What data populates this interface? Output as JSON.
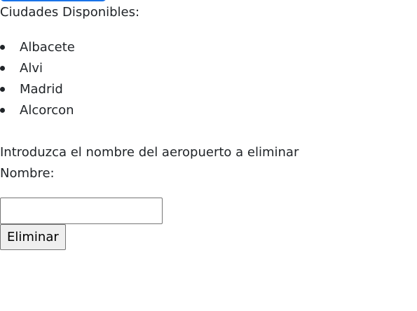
{
  "heading": "Ciudades Disponibles:",
  "cities": [
    {
      "label": "Albacete"
    },
    {
      "label": "Alvi"
    },
    {
      "label": "Madrid"
    },
    {
      "label": "Alcorcon"
    }
  ],
  "form": {
    "instruction": "Introduzca el nombre del aeropuerto a eliminar",
    "name_label": "Nombre:",
    "name_value": "",
    "submit_label": "Eliminar"
  },
  "colors": {
    "top_button": "#1a73e8",
    "text": "#212529"
  }
}
